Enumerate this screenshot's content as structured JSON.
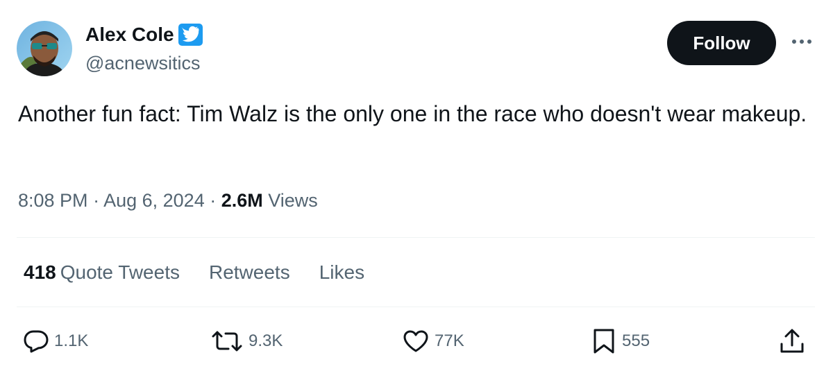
{
  "author": {
    "display_name": "Alex Cole",
    "handle": "@acnewsitics",
    "verified": true
  },
  "follow_button": {
    "label": "Follow"
  },
  "tweet": {
    "text": "Another fun fact: Tim Walz is the only one in the race who doesn't wear makeup.",
    "time": "8:08 PM",
    "separator": " · ",
    "date": "Aug 6, 2024",
    "views_count": "2.6M",
    "views_label": " Views"
  },
  "stats": {
    "quote_tweets_count": "418",
    "quote_tweets_label": "Quote Tweets",
    "retweets_label": "Retweets",
    "likes_label": "Likes"
  },
  "actions": {
    "reply_count": "1.1K",
    "retweet_count": "9.3K",
    "like_count": "77K",
    "bookmark_count": "555"
  },
  "icons": {
    "verified": "verified-badge-icon",
    "more": "more-icon",
    "reply": "reply-icon",
    "retweet": "retweet-icon",
    "like": "heart-icon",
    "bookmark": "bookmark-icon",
    "share": "share-icon"
  },
  "colors": {
    "text_primary": "#0f1419",
    "text_secondary": "#536471",
    "verified_blue": "#1d9bf0",
    "follow_bg": "#0f1419",
    "divider": "#eff3f4"
  }
}
